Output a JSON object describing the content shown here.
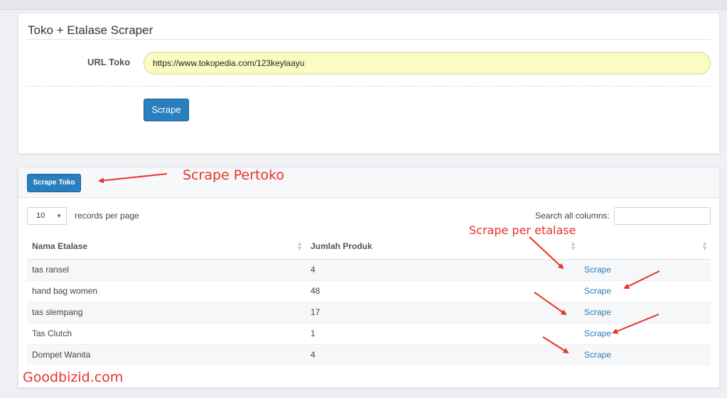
{
  "form": {
    "title": "Toko + Etalase Scraper",
    "url_label": "URL Toko",
    "url_value": "https://www.tokopedia.com/123keylaayu",
    "scrape_button": "Scrape"
  },
  "results": {
    "scrape_toko_button": "Scrape Toko",
    "page_length": "10",
    "page_length_label": "records per page",
    "search_label": "Search all columns:",
    "search_value": "",
    "columns": [
      "Nama Etalase",
      "Jumlah Produk",
      ""
    ],
    "rows": [
      {
        "nama": "tas ransel",
        "jumlah": "4",
        "action": "Scrape"
      },
      {
        "nama": "hand bag women",
        "jumlah": "48",
        "action": "Scrape"
      },
      {
        "nama": "tas slempang",
        "jumlah": "17",
        "action": "Scrape"
      },
      {
        "nama": "Tas Clutch",
        "jumlah": "1",
        "action": "Scrape"
      },
      {
        "nama": "Dompet Wanita",
        "jumlah": "4",
        "action": "Scrape"
      }
    ]
  },
  "annotations": {
    "pertoko": "Scrape Pertoko",
    "per_etalase": "Scrape per etalase",
    "brand": "Goodbizid.com"
  },
  "colors": {
    "primary_button": "#2a7fbf",
    "url_field_bg": "#fbfcc2",
    "annotation_red": "#e8322a",
    "link": "#2a7fbf"
  }
}
